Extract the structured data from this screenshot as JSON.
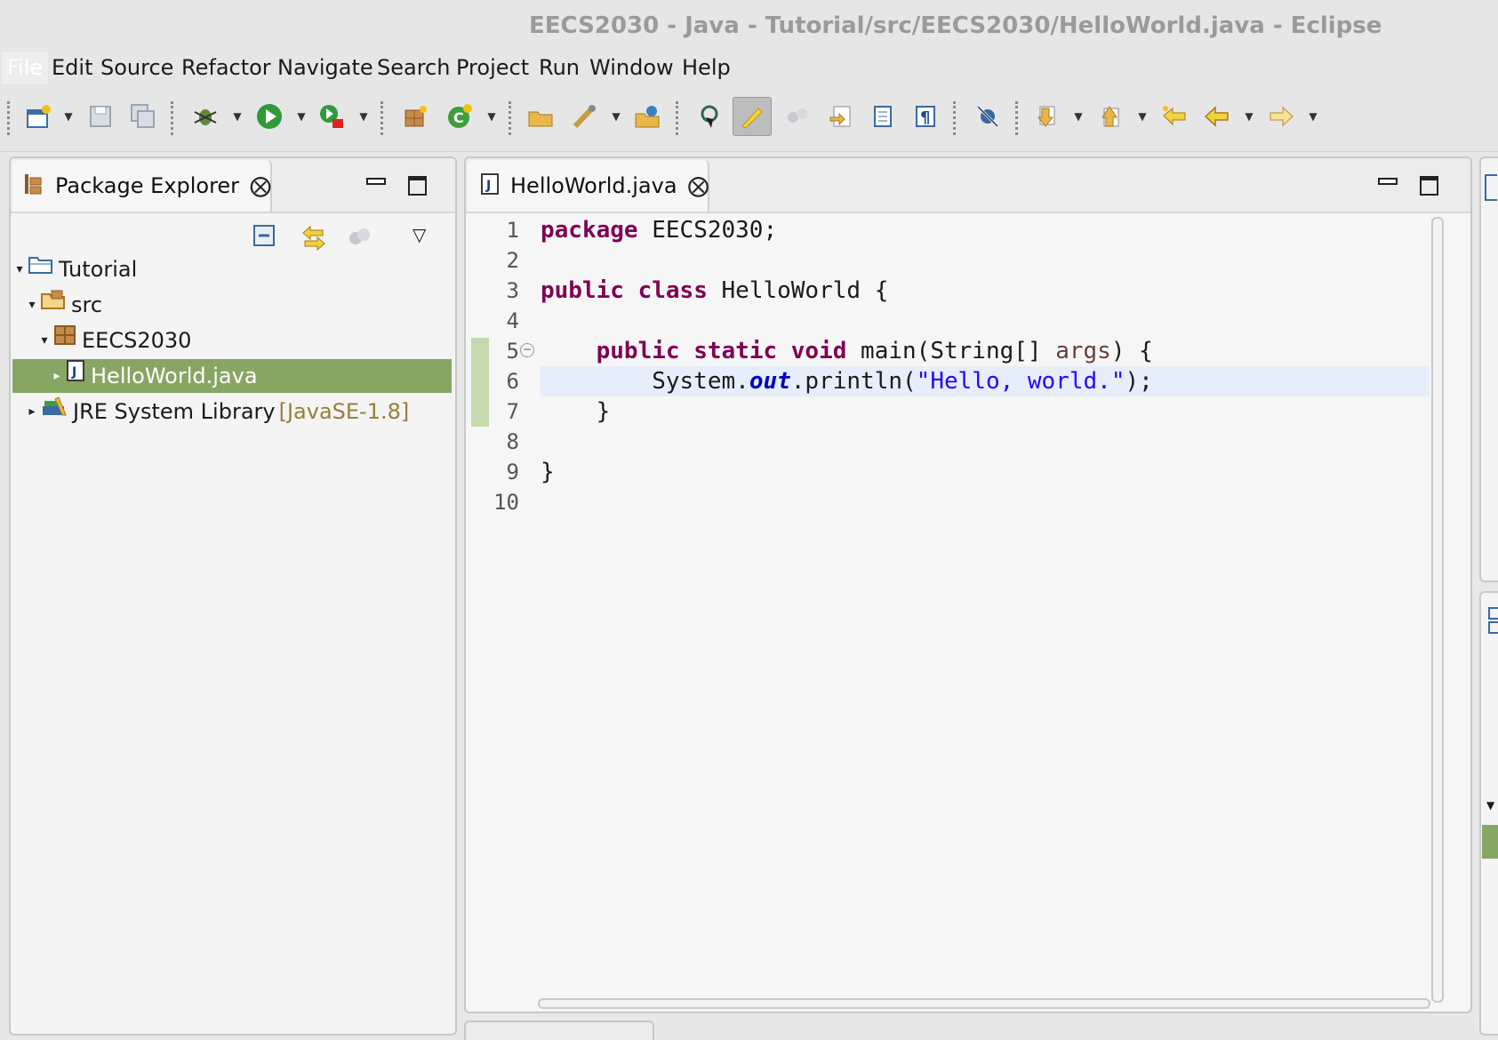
{
  "window": {
    "title": "EECS2030 - Java - Tutorial/src/EECS2030/HelloWorld.java - Eclipse"
  },
  "menu": [
    {
      "label": "File"
    },
    {
      "label": "Edit"
    },
    {
      "label": "Source"
    },
    {
      "label": "Refactor"
    },
    {
      "label": "Navigate"
    },
    {
      "label": "Search"
    },
    {
      "label": "Project"
    },
    {
      "label": "Run"
    },
    {
      "label": "Window"
    },
    {
      "label": "Help"
    }
  ],
  "toolbar": {
    "icons": [
      "new-wizard-icon",
      "save-icon",
      "save-all-icon",
      "debug-icon",
      "run-icon",
      "run-external-tool-icon",
      "new-java-package-icon",
      "new-java-class-icon",
      "open-type-icon",
      "open-task-icon",
      "search-icon",
      "toggle-breadcrumb-icon",
      "toggle-mark-occurrences-icon",
      "toggle-block-selection-icon",
      "next-annotation-icon",
      "previous-annotation-icon",
      "show-whitespace-icon",
      "skip-all-breakpoints-icon",
      "last-edit-location-icon",
      "back-icon",
      "forward-icon"
    ]
  },
  "package_explorer": {
    "title": "Package Explorer",
    "tree": [
      {
        "label": "Tutorial",
        "icon": "project-folder-icon",
        "expanded": true
      },
      {
        "label": "src",
        "icon": "source-folder-icon",
        "expanded": true
      },
      {
        "label": "EECS2030",
        "icon": "package-icon",
        "expanded": true
      },
      {
        "label": "HelloWorld.java",
        "icon": "java-file-icon",
        "expanded": false,
        "selected": true
      },
      {
        "label": "JRE System Library",
        "decoration": "[JavaSE-1.8]",
        "icon": "library-icon",
        "expanded": false
      }
    ]
  },
  "editor": {
    "tab_label": "HelloWorld.java",
    "line_numbers": [
      "1",
      "2",
      "3",
      "4",
      "5",
      "6",
      "7",
      "8",
      "9",
      "10"
    ],
    "current_line": 6,
    "code": {
      "l1_kw": "package",
      "l1_rest": " EECS2030;",
      "l3_kw1": "public",
      "l3_kw2": "class",
      "l3_rest": " HelloWorld {",
      "l5_indent": "    ",
      "l5_kw1": "public",
      "l5_kw2": "static",
      "l5_kw3": "void",
      "l5_mid": " main(String[] ",
      "l5_arg": "args",
      "l5_end": ") {",
      "l6_pre": "        System.",
      "l6_field": "out",
      "l6_mid": ".println(",
      "l6_str": "\"Hello, world.\"",
      "l6_end": ");",
      "l7": "    }",
      "l9": "}"
    }
  },
  "colors": {
    "keyword": "#7f0055",
    "string": "#2a00ff",
    "field": "#0000c0",
    "selection": "#88a663",
    "current_line": "#e6eefb"
  }
}
